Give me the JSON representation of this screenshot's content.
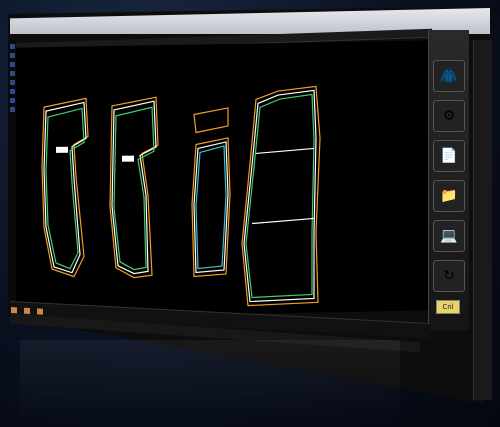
{
  "window": {
    "menu_items": [
      "",
      "",
      "",
      "",
      "",
      "",
      "",
      "",
      "",
      "",
      "",
      "",
      "",
      ""
    ]
  },
  "right_panel": {
    "items": [
      {
        "icon": "mannequin-icon"
      },
      {
        "icon": "sewing-machine-icon"
      },
      {
        "icon": "stack-of-sheets-icon"
      },
      {
        "icon": "folder-icon"
      },
      {
        "icon": "computer-tool-icon"
      },
      {
        "icon": "rotate-pattern-icon"
      }
    ],
    "cancel_label": "Cnl"
  },
  "canvas": {
    "pattern_pieces": [
      "front-bodice-1",
      "front-bodice-2",
      "sleeve",
      "back-panel"
    ],
    "colors": {
      "outline_primary": "#ffffff",
      "outline_accent": "#f0a020",
      "outline_green": "#40d070",
      "outline_cyan": "#40c0d0"
    }
  }
}
